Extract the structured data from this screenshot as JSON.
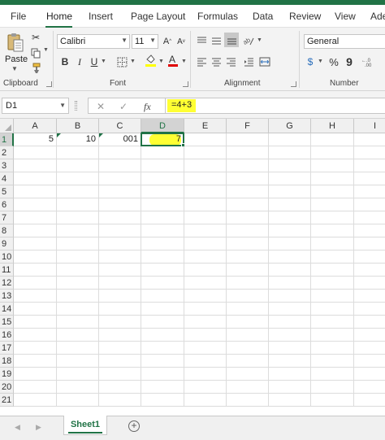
{
  "menu": {
    "tabs": [
      {
        "label": "File"
      },
      {
        "label": "Home"
      },
      {
        "label": "Insert"
      },
      {
        "label": "Page Layout"
      },
      {
        "label": "Formulas"
      },
      {
        "label": "Data"
      },
      {
        "label": "Review"
      },
      {
        "label": "View"
      },
      {
        "label": "Ade"
      }
    ],
    "active": "Home"
  },
  "ribbon": {
    "clipboard": {
      "label": "Clipboard",
      "paste_label": "Paste"
    },
    "font": {
      "label": "Font",
      "font_name": "Calibri",
      "font_size": "11"
    },
    "alignment": {
      "label": "Alignment"
    },
    "number": {
      "label": "Number",
      "format": "General",
      "currency_symbol": "$",
      "percent_symbol": "%",
      "comma_symbol": "9"
    }
  },
  "formula_bar": {
    "name_box": "D1",
    "fx_label": "fx",
    "formula": "=4+3"
  },
  "grid": {
    "columns": [
      "A",
      "B",
      "C",
      "D",
      "E",
      "F",
      "G",
      "H",
      "I"
    ],
    "rows": [
      "1",
      "2",
      "3",
      "4",
      "5",
      "6",
      "7",
      "8",
      "9",
      "10",
      "11",
      "12",
      "13",
      "14",
      "15",
      "16",
      "17",
      "18",
      "19",
      "20",
      "21"
    ],
    "active_cell": "D1",
    "cells": {
      "A1": "5",
      "B1": "10",
      "C1": "001",
      "D1": "7"
    },
    "highlight_color": "#ffff33",
    "accent_color": "#217346"
  },
  "sheets": {
    "tabs": [
      {
        "label": "Sheet1"
      }
    ],
    "active": "Sheet1"
  }
}
